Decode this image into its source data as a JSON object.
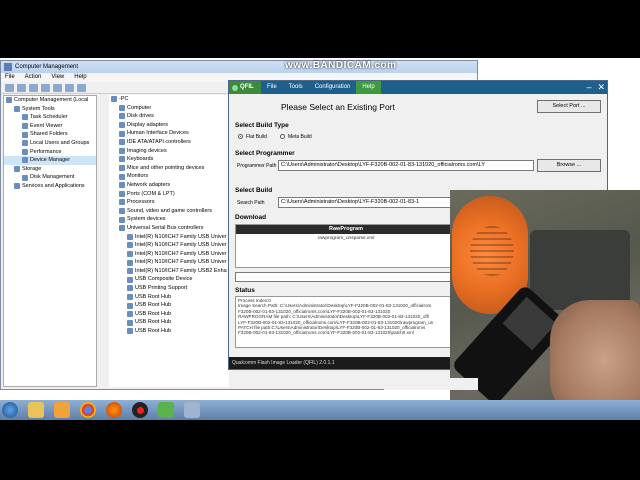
{
  "watermark": "www.BANDICAM.com",
  "computer_management": {
    "title": "Computer Management",
    "menu": [
      "File",
      "Action",
      "View",
      "Help"
    ],
    "tree": [
      {
        "label": "Computer Management (Local",
        "indent": 0
      },
      {
        "label": "System Tools",
        "indent": 1
      },
      {
        "label": "Task Scheduler",
        "indent": 2
      },
      {
        "label": "Event Viewer",
        "indent": 2
      },
      {
        "label": "Shared Folders",
        "indent": 2
      },
      {
        "label": "Local Users and Groups",
        "indent": 2
      },
      {
        "label": "Performance",
        "indent": 2
      },
      {
        "label": "Device Manager",
        "indent": 2,
        "selected": true
      },
      {
        "label": "Storage",
        "indent": 1
      },
      {
        "label": "Disk Management",
        "indent": 2
      },
      {
        "label": "Services and Applications",
        "indent": 1
      }
    ],
    "devices": [
      {
        "label": "-PC",
        "indent": 0
      },
      {
        "label": "Computer",
        "indent": 1
      },
      {
        "label": "Disk drives",
        "indent": 1
      },
      {
        "label": "Display adapters",
        "indent": 1
      },
      {
        "label": "Human Interface Devices",
        "indent": 1
      },
      {
        "label": "IDE ATA/ATAPI controllers",
        "indent": 1
      },
      {
        "label": "Imaging devices",
        "indent": 1
      },
      {
        "label": "Keyboards",
        "indent": 1
      },
      {
        "label": "Mice and other pointing devices",
        "indent": 1
      },
      {
        "label": "Monitors",
        "indent": 1
      },
      {
        "label": "Network adapters",
        "indent": 1
      },
      {
        "label": "Ports (COM & LPT)",
        "indent": 1
      },
      {
        "label": "Processors",
        "indent": 1
      },
      {
        "label": "Sound, video and game controllers",
        "indent": 1
      },
      {
        "label": "System devices",
        "indent": 1
      },
      {
        "label": "Universal Serial Bus controllers",
        "indent": 1
      },
      {
        "label": "Intel(R) N10/ICH7 Family USB Univer",
        "indent": 2
      },
      {
        "label": "Intel(R) N10/ICH7 Family USB Univer",
        "indent": 2
      },
      {
        "label": "Intel(R) N10/ICH7 Family USB Univer",
        "indent": 2
      },
      {
        "label": "Intel(R) N10/ICH7 Family USB Univer",
        "indent": 2
      },
      {
        "label": "Intel(R) N10/ICH7 Family USB2 Enha",
        "indent": 2
      },
      {
        "label": "USB Composite Device",
        "indent": 2
      },
      {
        "label": "USB Printing Support",
        "indent": 2
      },
      {
        "label": "USB Root Hub",
        "indent": 2
      },
      {
        "label": "USB Root Hub",
        "indent": 2
      },
      {
        "label": "USB Root Hub",
        "indent": 2
      },
      {
        "label": "USB Root Hub",
        "indent": 2
      },
      {
        "label": "USB Root Hub",
        "indent": 2
      }
    ]
  },
  "qfil": {
    "logo": "QFIL",
    "menu": [
      "File",
      "Tools",
      "Configuration",
      "Help"
    ],
    "window_controls": [
      "–",
      "✕"
    ],
    "select_port_heading": "Please Select an Existing Port",
    "select_port_button": "Select Port ...",
    "select_build_type": "Select Build Type",
    "flat_build": "Flat Build",
    "meta_build": "Meta Build",
    "select_programmer": "Select Programmer",
    "programmer_path_label": "Programmer Path",
    "programmer_path_value": "C:\\Users\\Administrator\\Desktop\\LYF-F320B-002-01-83-131020_officialroms.com\\LY",
    "browse_button": "Browse ...",
    "select_build": "Select Build",
    "search_path_label": "Search Path",
    "search_path_value": "C:\\Users\\Administrator\\Desktop\\LYF-F320B-002-01-83-1",
    "download": "Download",
    "table_header": "RawProgram",
    "table_rows": [
      "rawprogram_unsparse.xml"
    ],
    "status_label": "Status",
    "status_lines": [
      "Process Index:0",
      "Image Search Path: C:\\Users\\Administrator\\Desktop\\LYF-F320B-002-01-83-131020_officialrom",
      "F320B-002-01-83-131020_officialroms.com\\LYF-F320B-002-01-83-131020",
      "RAWPROGRAM file path: C:\\Users\\Administrator\\Desktop\\LYF-F320B-002-01-83-131020_offi",
      "LYF-F320B-002-01-83-131020_officialroms.com\\LYF-F320B-002-01-83-131020\\rawprogram_un",
      "PATCH file path:C:\\Users\\Administrator\\Desktop\\LYF-F320B-002-01-83-131020_officialroms",
      "F320B-002-01-83-131020_officialroms.com\\LYF-F320B-002-01-83-131020\\patch0.xml"
    ],
    "footer": "Qualcomm Flash Image Loader (QFIL)     2.0.1.1"
  },
  "taskbar": {
    "icons": [
      "start-orb-icon",
      "folder-icon",
      "media-player-icon",
      "chrome-icon",
      "firefox-icon",
      "record-icon",
      "download-icon",
      "network-icon"
    ]
  }
}
